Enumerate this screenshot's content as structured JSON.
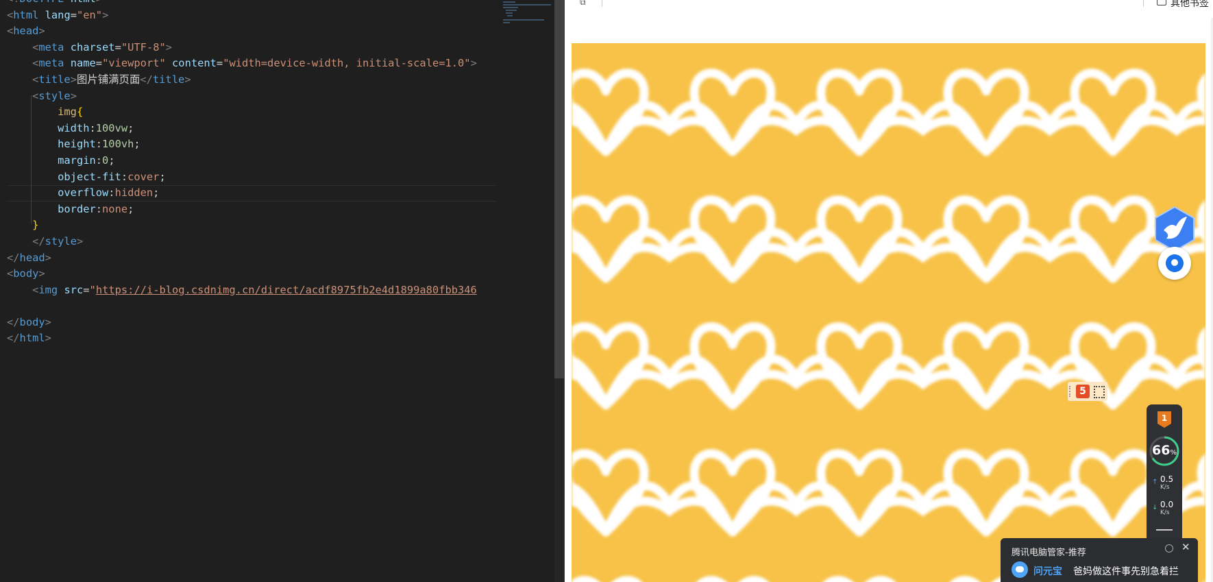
{
  "editor": {
    "lines": [
      [
        [
          "punct",
          "<!"
        ],
        [
          "tag",
          "DOCTYPE"
        ],
        [
          "text",
          " "
        ],
        [
          "attr",
          "html"
        ],
        [
          "punct",
          ">"
        ]
      ],
      [
        [
          "punct",
          "<"
        ],
        [
          "tag",
          "html"
        ],
        [
          "text",
          " "
        ],
        [
          "attr",
          "lang"
        ],
        [
          "text",
          "="
        ],
        [
          "str",
          "\"en\""
        ],
        [
          "punct",
          ">"
        ]
      ],
      [
        [
          "punct",
          "<"
        ],
        [
          "tag",
          "head"
        ],
        [
          "punct",
          ">"
        ]
      ],
      [
        [
          "text",
          "    "
        ],
        [
          "punct",
          "<"
        ],
        [
          "tag",
          "meta"
        ],
        [
          "text",
          " "
        ],
        [
          "attr",
          "charset"
        ],
        [
          "text",
          "="
        ],
        [
          "str",
          "\"UTF-8\""
        ],
        [
          "punct",
          ">"
        ]
      ],
      [
        [
          "text",
          "    "
        ],
        [
          "punct",
          "<"
        ],
        [
          "tag",
          "meta"
        ],
        [
          "text",
          " "
        ],
        [
          "attr",
          "name"
        ],
        [
          "text",
          "="
        ],
        [
          "str",
          "\"viewport\""
        ],
        [
          "text",
          " "
        ],
        [
          "attr",
          "content"
        ],
        [
          "text",
          "="
        ],
        [
          "str",
          "\"width=device-width, initial-scale=1.0\""
        ],
        [
          "punct",
          ">"
        ]
      ],
      [
        [
          "text",
          "    "
        ],
        [
          "punct",
          "<"
        ],
        [
          "tag",
          "title"
        ],
        [
          "punct",
          ">"
        ],
        [
          "text",
          "图片铺满页面"
        ],
        [
          "punct",
          "</"
        ],
        [
          "tag",
          "title"
        ],
        [
          "punct",
          ">"
        ]
      ],
      [
        [
          "text",
          "    "
        ],
        [
          "punct",
          "<"
        ],
        [
          "tag",
          "style"
        ],
        [
          "punct",
          ">"
        ]
      ],
      [
        [
          "text",
          "        "
        ],
        [
          "sel",
          "img"
        ],
        [
          "brace",
          "{"
        ]
      ],
      [
        [
          "text",
          "        "
        ],
        [
          "prop",
          "width"
        ],
        [
          "text",
          ":"
        ],
        [
          "num",
          "100vw"
        ],
        [
          "text",
          ";"
        ]
      ],
      [
        [
          "text",
          "        "
        ],
        [
          "prop",
          "height"
        ],
        [
          "text",
          ":"
        ],
        [
          "num",
          "100vh"
        ],
        [
          "text",
          ";"
        ]
      ],
      [
        [
          "text",
          "        "
        ],
        [
          "prop",
          "margin"
        ],
        [
          "text",
          ":"
        ],
        [
          "num",
          "0"
        ],
        [
          "text",
          ";"
        ]
      ],
      [
        [
          "text",
          "        "
        ],
        [
          "prop",
          "object-fit"
        ],
        [
          "text",
          ":"
        ],
        [
          "val",
          "cover"
        ],
        [
          "text",
          ";"
        ]
      ],
      [
        [
          "text",
          "        "
        ],
        [
          "prop",
          "overflow"
        ],
        [
          "text",
          ":"
        ],
        [
          "val",
          "hidden"
        ],
        [
          "text",
          ";"
        ]
      ],
      [
        [
          "text",
          "        "
        ],
        [
          "prop",
          "border"
        ],
        [
          "text",
          ":"
        ],
        [
          "val",
          "none"
        ],
        [
          "text",
          ";"
        ]
      ],
      [
        [
          "text",
          "    "
        ],
        [
          "brace",
          "}"
        ]
      ],
      [
        [
          "text",
          "    "
        ],
        [
          "punct",
          "</"
        ],
        [
          "tag",
          "style"
        ],
        [
          "punct",
          ">"
        ]
      ],
      [
        [
          "punct",
          "</"
        ],
        [
          "tag",
          "head"
        ],
        [
          "punct",
          ">"
        ]
      ],
      [
        [
          "punct",
          "<"
        ],
        [
          "tag",
          "body"
        ],
        [
          "punct",
          ">"
        ]
      ],
      [
        [
          "text",
          "    "
        ],
        [
          "punct",
          "<"
        ],
        [
          "tag",
          "img"
        ],
        [
          "text",
          " "
        ],
        [
          "attr",
          "src"
        ],
        [
          "text",
          "="
        ],
        [
          "str",
          "\""
        ],
        [
          "url",
          "https://i-blog.csdnimg.cn/direct/acdf8975fb2e4d1899a80fbb346"
        ]
      ],
      [],
      [
        [
          "punct",
          "</"
        ],
        [
          "tag",
          "body"
        ],
        [
          "punct",
          ">"
        ]
      ],
      [
        [
          "punct",
          "</"
        ],
        [
          "tag",
          "html"
        ],
        [
          "punct",
          ">"
        ]
      ]
    ]
  },
  "browser": {
    "bookmarks_other_label": "其他书签",
    "page_background": "#f7c247"
  },
  "widgets": {
    "speed": {
      "rank": "1",
      "percent": "66",
      "percent_sign": "%",
      "upload_value": "0.5",
      "upload_unit": "K/s",
      "download_value": "0.0",
      "download_unit": "K/s"
    },
    "toast": {
      "title": "腾讯电脑管家-推荐",
      "app_name": "问元宝",
      "message": "爸妈做这件事先别急着拦",
      "close": "✕"
    }
  }
}
